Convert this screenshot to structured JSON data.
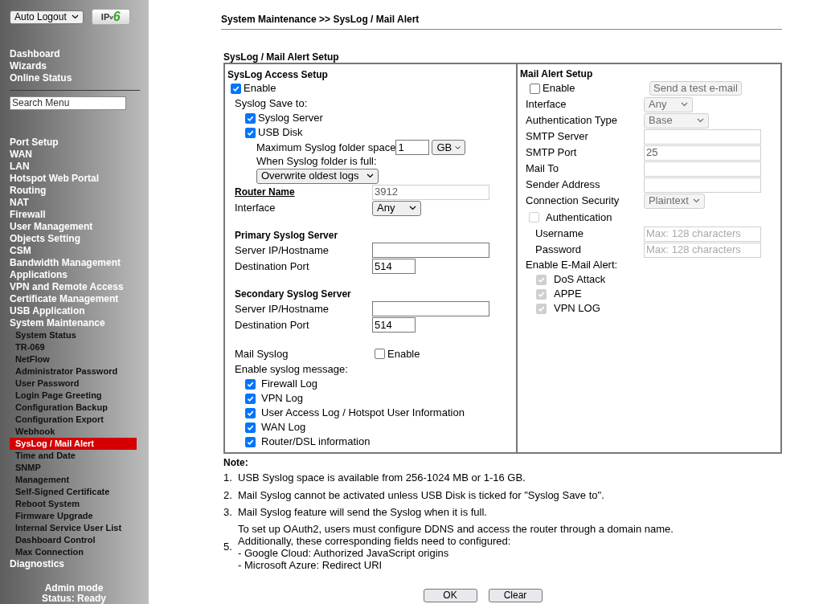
{
  "sidebar": {
    "auto_logout": "Auto Logout",
    "ipv6_logo": {
      "main": "IP",
      "sub": "v",
      "accent": "6"
    },
    "top_links": [
      "Dashboard",
      "Wizards",
      "Online Status"
    ],
    "search": {
      "placeholder": "Search Menu"
    },
    "menu": [
      {
        "label": "Port Setup",
        "selected": false
      },
      {
        "label": "WAN",
        "selected": false
      },
      {
        "label": "LAN",
        "selected": false
      },
      {
        "label": "Hotspot Web Portal",
        "selected": false
      },
      {
        "label": "Routing",
        "selected": false
      },
      {
        "label": "NAT",
        "selected": false
      },
      {
        "label": "Firewall",
        "selected": false
      },
      {
        "label": "User Management",
        "selected": false
      },
      {
        "label": "Objects Setting",
        "selected": false
      },
      {
        "label": "CSM",
        "selected": false
      },
      {
        "label": "Bandwidth Management",
        "selected": false
      },
      {
        "label": "Applications",
        "selected": false
      },
      {
        "label": "VPN and Remote Access",
        "selected": false
      },
      {
        "label": "Certificate Management",
        "selected": false
      },
      {
        "label": "USB Application",
        "selected": false
      },
      {
        "label": "System Maintenance",
        "selected": false,
        "children": [
          {
            "label": "System Status",
            "selected": false
          },
          {
            "label": "TR-069",
            "selected": false
          },
          {
            "label": "NetFlow",
            "selected": false
          },
          {
            "label": "Administrator Password",
            "selected": false
          },
          {
            "label": "User Password",
            "selected": false
          },
          {
            "label": "Login Page Greeting",
            "selected": false
          },
          {
            "label": "Configuration Backup",
            "selected": false
          },
          {
            "label": "Configuration Export",
            "selected": false
          },
          {
            "label": "Webhook",
            "selected": false
          },
          {
            "label": "SysLog / Mail Alert",
            "selected": true
          },
          {
            "label": "Time and Date",
            "selected": false
          },
          {
            "label": "SNMP",
            "selected": false
          },
          {
            "label": "Management",
            "selected": false
          },
          {
            "label": "Self-Signed Certificate",
            "selected": false
          },
          {
            "label": "Reboot System",
            "selected": false
          },
          {
            "label": "Firmware Upgrade",
            "selected": false
          },
          {
            "label": "Internal Service User List",
            "selected": false
          },
          {
            "label": "Dashboard Control",
            "selected": false
          },
          {
            "label": "Max Connection",
            "selected": false
          }
        ]
      },
      {
        "label": "Diagnostics",
        "selected": false
      }
    ],
    "footer": [
      "Admin mode",
      "Status: Ready"
    ]
  },
  "breadcrumb": "System Maintenance >> SysLog / Mail Alert",
  "section_title": "SysLog / Mail Alert Setup",
  "syslog": {
    "title": "SysLog Access Setup",
    "enable": {
      "label": "Enable",
      "checked": true
    },
    "save_to_label": "Syslog Save to:",
    "save_to": [
      {
        "label": "Syslog Server",
        "checked": true
      },
      {
        "label": "USB Disk",
        "checked": true
      }
    ],
    "max_space": {
      "label": "Maximum Syslog folder space",
      "value": "1",
      "unit": "GB"
    },
    "when_full": {
      "label": "When Syslog folder is full:",
      "value": "Overwrite oldest logs"
    },
    "router_name": {
      "label": "Router Name",
      "value": "3912"
    },
    "interface": {
      "label": "Interface",
      "value": "Any"
    },
    "servers": [
      {
        "title": "Primary Syslog Server",
        "host_label": "Server IP/Hostname",
        "port_label": "Destination Port",
        "port": "514"
      },
      {
        "title": "Secondary Syslog Server",
        "host_label": "Server IP/Hostname",
        "port_label": "Destination Port",
        "port": "514"
      }
    ],
    "mail_syslog": {
      "label": "Mail Syslog",
      "checkbox_label": "Enable",
      "checked": false
    },
    "messages_label": "Enable syslog message:",
    "messages": [
      {
        "label": "Firewall Log",
        "checked": true
      },
      {
        "label": "VPN Log",
        "checked": true
      },
      {
        "label": "User Access Log / Hotspot User Information",
        "checked": true
      },
      {
        "label": "WAN Log",
        "checked": true
      },
      {
        "label": "Router/DSL information",
        "checked": true
      }
    ]
  },
  "mail_alert": {
    "title": "Mail Alert Setup",
    "enable": {
      "label": "Enable",
      "checked": false
    },
    "test_button": "Send a test e-mail",
    "fields": [
      {
        "label": "Interface",
        "kind": "select",
        "value": "Any"
      },
      {
        "label": "Authentication Type",
        "kind": "select",
        "value": "Base"
      },
      {
        "label": "SMTP Server",
        "kind": "input"
      },
      {
        "label": "SMTP Port",
        "kind": "input",
        "value": "25"
      },
      {
        "label": "Mail To",
        "kind": "input"
      },
      {
        "label": "Sender Address",
        "kind": "input"
      },
      {
        "label": "Connection Security",
        "kind": "select",
        "value": "Plaintext"
      }
    ],
    "authentication": {
      "label": "Authentication",
      "checked": false
    },
    "credentials": [
      {
        "label": "Username",
        "placeholder": "Max: 128 characters"
      },
      {
        "label": "Password",
        "placeholder": "Max: 128 characters"
      }
    ],
    "alerts_label": "Enable E-Mail Alert:",
    "alerts": [
      {
        "label": "DoS Attack",
        "checked": true
      },
      {
        "label": "APPE",
        "checked": true
      },
      {
        "label": "VPN LOG",
        "checked": true
      }
    ]
  },
  "note": {
    "title": "Note:",
    "items": [
      {
        "number": "1.",
        "lines": [
          "USB Syslog space is available from 256-1024 MB or 1-16 GB."
        ]
      },
      {
        "number": "2.",
        "lines": [
          "Mail Syslog cannot be activated unless USB Disk is ticked for \"Syslog Save to\"."
        ]
      },
      {
        "number": "3.",
        "lines": [
          "Mail Syslog feature will send the Syslog when it is full."
        ]
      },
      {
        "number": "5.",
        "lines": [
          "To set up OAuth2, users must configure DDNS and access the router through a domain name.",
          "Additionally, these corresponding fields need to configured:",
          "- Google Cloud: Authorized JavaScript origins",
          "- Microsoft Azure: Redirect URI"
        ]
      }
    ]
  },
  "buttons": [
    "OK",
    "Clear"
  ]
}
